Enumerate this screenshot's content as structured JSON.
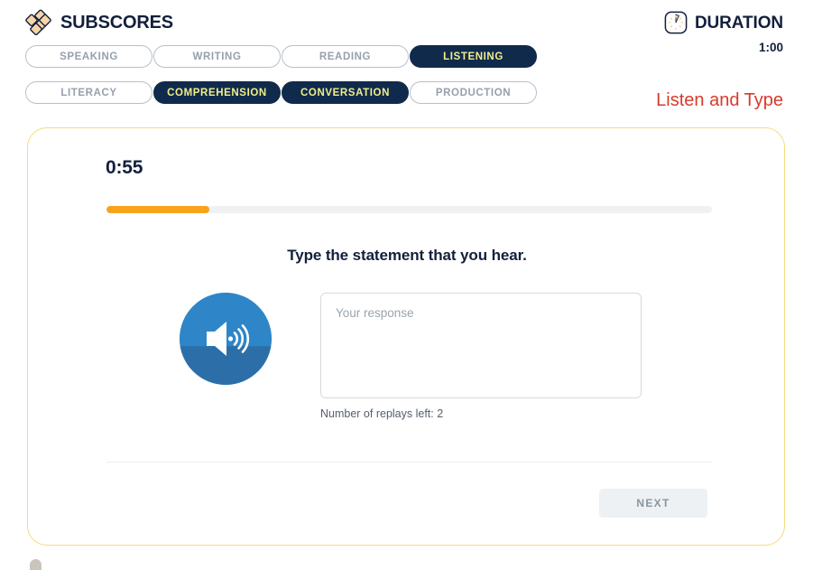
{
  "header": {
    "brand": {
      "logo_icon": "diamond-lattice-logo-icon",
      "title": "SUBSCORES"
    },
    "subscore_pills_row1": [
      {
        "label": "SPEAKING",
        "active": false
      },
      {
        "label": "WRITING",
        "active": false
      },
      {
        "label": "READING",
        "active": false
      },
      {
        "label": "LISTENING",
        "active": true
      }
    ],
    "subscore_pills_row2": [
      {
        "label": "LITERACY",
        "active": false
      },
      {
        "label": "COMPREHENSION",
        "active": true
      },
      {
        "label": "CONVERSATION",
        "active": true
      },
      {
        "label": "PRODUCTION",
        "active": false
      }
    ],
    "duration": {
      "clock_icon": "clock-icon",
      "label": "DURATION",
      "value": "1:00"
    },
    "task_type": "Listen and Type"
  },
  "card": {
    "timer": "0:55",
    "progress_percent": 17,
    "question_prompt": "Type the statement that you hear.",
    "audio": {
      "icon": "speaker-volume-icon",
      "play_progress_percent": 42
    },
    "response": {
      "value": "",
      "placeholder": "Your response"
    },
    "replays_left_text": "Number of replays left: 2",
    "next_label": "NEXT"
  },
  "colors": {
    "navy": "#102a4c",
    "pill_active_text": "#f2ee8a",
    "accent_orange": "#f8a31c",
    "task_red": "#d93a2b",
    "card_border": "#f3dd7c",
    "audio_blue": "#2e86c8",
    "audio_blue_dark": "#2c6fa8"
  }
}
